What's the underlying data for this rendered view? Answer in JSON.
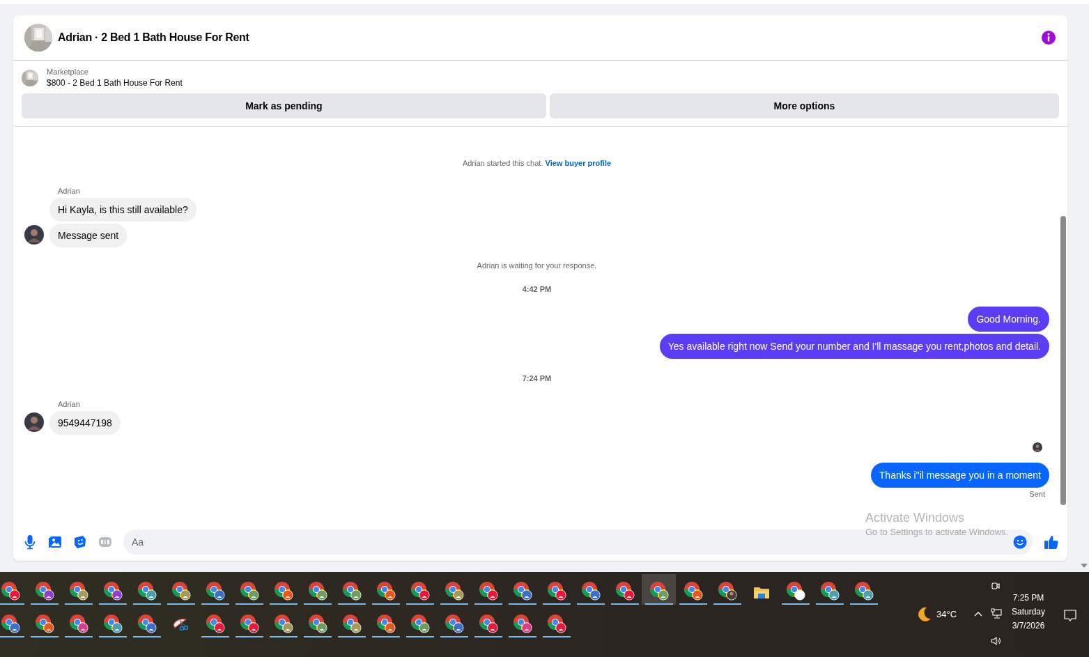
{
  "chat_header": {
    "title": "Adrian · 2 Bed 1 Bath House For Rent"
  },
  "listing": {
    "source": "Marketplace",
    "title": "$800 - 2 Bed 1 Bath House For Rent"
  },
  "actions": [
    "Mark as pending",
    "More options"
  ],
  "messages": [
    {
      "kind": "notice",
      "text": "Adrian started this chat.",
      "link": "View buyer profile"
    },
    {
      "kind": "sender",
      "text": "Adrian"
    },
    {
      "kind": "incoming",
      "text": "Hi Kayla, is this still available?",
      "avatar": false
    },
    {
      "kind": "incoming",
      "text": "Message sent",
      "avatar": true
    },
    {
      "kind": "notice",
      "text": "Adrian is waiting for your response."
    },
    {
      "kind": "time",
      "text": "4:42 PM"
    },
    {
      "kind": "outgoing",
      "text": "Good Morning.",
      "color": "#5b3df5"
    },
    {
      "kind": "outgoing",
      "text": "Yes available right now Send your number and I'll massage you rent,photos and detail.",
      "color": "#5b3df5"
    },
    {
      "kind": "time",
      "text": "7:24 PM"
    },
    {
      "kind": "sender",
      "text": "Adrian"
    },
    {
      "kind": "incoming",
      "text": "9549447198",
      "avatar": true
    },
    {
      "kind": "seen"
    },
    {
      "kind": "outgoing",
      "text": "Thanks i\"il message you in a moment",
      "color": "#0866ff"
    },
    {
      "kind": "status",
      "text": "Sent"
    }
  ],
  "composer": {
    "placeholder": "Aa"
  },
  "activation": {
    "title": "Activate Windows",
    "subtitle": "Go to Settings to activate Windows."
  },
  "taskbar": {
    "rows": [
      [
        {
          "kind": "chrome",
          "color": "#e8173b",
          "running": true,
          "selected": false
        },
        {
          "kind": "chrome",
          "color": "#8e3fd0",
          "running": true,
          "selected": false
        },
        {
          "kind": "chrome",
          "color": "#a59a5a",
          "running": true,
          "selected": false
        },
        {
          "kind": "chrome",
          "color": "#8e3fd0",
          "running": true,
          "selected": false
        },
        {
          "kind": "chrome",
          "color": "#4aa0b0",
          "running": true,
          "selected": false
        },
        {
          "kind": "chrome",
          "color": "#a59a5a",
          "running": true,
          "selected": false
        },
        {
          "kind": "chrome",
          "color": "#3a6fd0",
          "running": true,
          "selected": false
        },
        {
          "kind": "chrome",
          "color": "#6e9e5e",
          "running": true,
          "selected": false
        },
        {
          "kind": "chrome",
          "color": "#e8581b",
          "running": true,
          "selected": false
        },
        {
          "kind": "chrome",
          "color": "#6e9e5e",
          "running": true,
          "selected": false
        },
        {
          "kind": "chrome",
          "color": "#6e9e5e",
          "running": true,
          "selected": false
        },
        {
          "kind": "chrome",
          "color": "#e8581b",
          "running": true,
          "selected": false
        },
        {
          "kind": "chrome",
          "color": "#e8173b",
          "running": true,
          "selected": false
        },
        {
          "kind": "chrome",
          "color": "#a59a5a",
          "running": true,
          "selected": false
        },
        {
          "kind": "chrome",
          "color": "#e8173b",
          "running": true,
          "selected": false
        },
        {
          "kind": "chrome",
          "color": "#3a6fd0",
          "running": true,
          "selected": false
        },
        {
          "kind": "chrome",
          "color": "#e8173b",
          "running": true,
          "selected": false
        },
        {
          "kind": "chrome",
          "color": "#3a6fd0",
          "running": true,
          "selected": false
        },
        {
          "kind": "chrome",
          "color": "#e8173b",
          "running": true,
          "selected": false
        },
        {
          "kind": "chrome",
          "color": "#6e9e5e",
          "running": true,
          "selected": true
        },
        {
          "kind": "chrome",
          "color": "#e8581b",
          "running": true,
          "selected": false
        },
        {
          "kind": "chrome-avatar",
          "running": true,
          "selected": false
        },
        {
          "kind": "folder",
          "running": false,
          "selected": false
        },
        {
          "kind": "chrome-plain",
          "running": true,
          "selected": false
        },
        {
          "kind": "chrome",
          "color": "#4aa0b0",
          "running": true,
          "selected": false
        },
        {
          "kind": "chrome",
          "color": "#4aa0b0",
          "running": true,
          "selected": false
        }
      ],
      [
        {
          "kind": "chrome",
          "color": "#3a6fd0",
          "running": true,
          "selected": false
        },
        {
          "kind": "chrome",
          "color": "#e8581b",
          "running": true,
          "selected": false
        },
        {
          "kind": "chrome",
          "color": "#e03a8a",
          "running": true,
          "selected": false
        },
        {
          "kind": "chrome",
          "color": "#4aa0b0",
          "running": true,
          "selected": false
        },
        {
          "kind": "chrome",
          "color": "#3a6fd0",
          "running": true,
          "selected": false
        },
        {
          "kind": "snip",
          "running": false,
          "selected": false
        },
        {
          "kind": "chrome",
          "color": "#e8173b",
          "running": true,
          "selected": false
        },
        {
          "kind": "chrome",
          "color": "#e8173b",
          "running": true,
          "selected": false
        },
        {
          "kind": "chrome",
          "color": "#a59a5a",
          "running": true,
          "selected": false
        },
        {
          "kind": "chrome",
          "color": "#6e9e5e",
          "running": true,
          "selected": false
        },
        {
          "kind": "chrome",
          "color": "#a59a5a",
          "running": true,
          "selected": false
        },
        {
          "kind": "chrome",
          "color": "#e8581b",
          "running": true,
          "selected": false
        },
        {
          "kind": "chrome",
          "color": "#6e9e5e",
          "running": true,
          "selected": false
        },
        {
          "kind": "chrome",
          "color": "#3a6fd0",
          "running": true,
          "selected": false
        },
        {
          "kind": "chrome",
          "color": "#e8173b",
          "running": true,
          "selected": false
        },
        {
          "kind": "chrome",
          "color": "#e03a8a",
          "running": true,
          "selected": false
        },
        {
          "kind": "chrome",
          "color": "#e8173b",
          "running": true,
          "selected": false
        }
      ]
    ],
    "weather": "34°C",
    "time": "7:25 PM",
    "day": "Saturday",
    "date": "3/7/2026"
  }
}
